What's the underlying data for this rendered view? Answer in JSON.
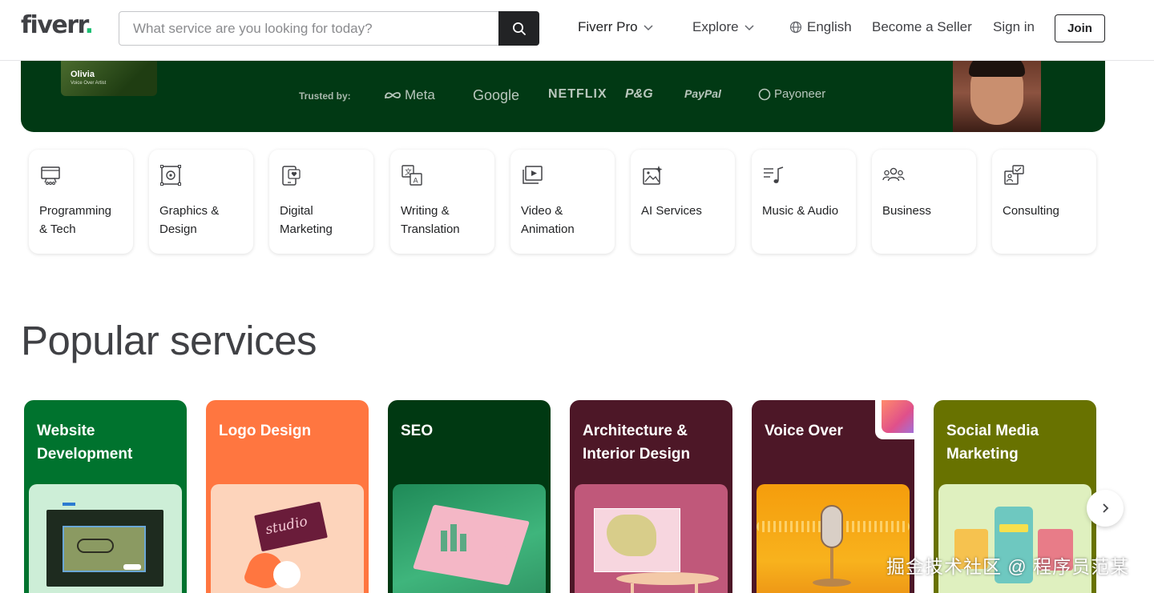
{
  "header": {
    "logo_text": "fiverr",
    "logo_dot": ".",
    "search_placeholder": "What service are you looking for today?",
    "nav": {
      "fiverr_pro": "Fiverr Pro",
      "explore": "Explore",
      "language": "English",
      "become_seller": "Become a Seller",
      "sign_in": "Sign in",
      "join": "Join"
    }
  },
  "hero": {
    "freelancer_name": "Olivia",
    "freelancer_role": "Voice Over Artist",
    "trusted_by": "Trusted by:",
    "brands": [
      "Meta",
      "Google",
      "NETFLIX",
      "P&G",
      "PayPal",
      "Payoneer"
    ]
  },
  "categories": [
    {
      "label": "Programming\n& Tech",
      "icon": "monitor-code-icon"
    },
    {
      "label": "Graphics &\nDesign",
      "icon": "design-frame-icon"
    },
    {
      "label": "Digital\nMarketing",
      "icon": "phone-heart-icon"
    },
    {
      "label": "Writing &\nTranslation",
      "icon": "translate-icon"
    },
    {
      "label": "Video &\nAnimation",
      "icon": "video-play-icon"
    },
    {
      "label": "AI Services",
      "icon": "ai-image-icon"
    },
    {
      "label": "Music & Audio",
      "icon": "music-note-icon"
    },
    {
      "label": "Business",
      "icon": "people-icon"
    },
    {
      "label": "Consulting",
      "icon": "consulting-icon"
    }
  ],
  "popular": {
    "title": "Popular services",
    "services": [
      {
        "label": "Website\nDevelopment",
        "color": "#00732e"
      },
      {
        "label": "Logo Design",
        "color": "#ff7640"
      },
      {
        "label": "SEO",
        "color": "#003912"
      },
      {
        "label": "Architecture &\nInterior Design",
        "color": "#4d1727"
      },
      {
        "label": "Voice Over",
        "color": "#687200"
      },
      {
        "label": "Social Media\nMarketing",
        "color": "#687200"
      }
    ]
  },
  "watermark": "掘金技术社区 @ 程序员范某"
}
